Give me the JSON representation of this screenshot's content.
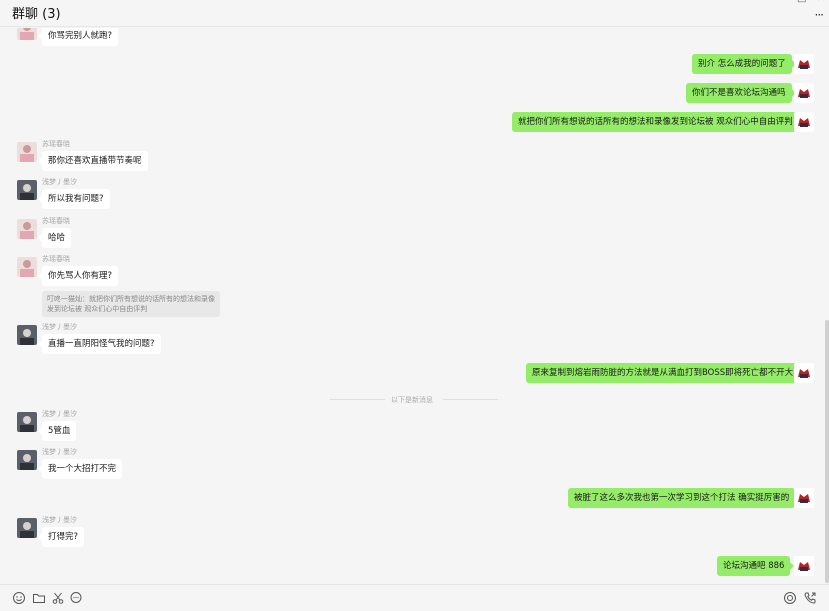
{
  "window": {
    "title": "群聊 (3)",
    "minimize_glyph": "─",
    "maximize_glyph": "□",
    "close_glyph": "✕",
    "more_glyph": "···"
  },
  "senders": {
    "a": "苏瑶春晓",
    "b": "浅梦丿墨汐"
  },
  "messages": {
    "m1": "你骂完别人就跑?",
    "m2": "别介 怎么成我的问题了",
    "m3": "你们不是喜欢论坛沟通吗",
    "m4": "就把你们所有想说的话所有的想法和录像发到论坛被 观众们心中自由评判",
    "m5": "那你还喜欢直播带节奏呢",
    "m6": "所以我有问题?",
    "m7": "哈哈",
    "m8": "你先骂人你有理?",
    "m9": "直播一直阴阳怪气我的问题?",
    "m10": "原来复制到熔岩雨防脏的方法就是从满血打到BOSS即将死亡都不开大",
    "m11": "5管血",
    "m12": "我一个大招打不完",
    "m13": "被脏了这么多次我也第一次学习到这个打法 确实挺厉害的",
    "m14": "打得完?",
    "m15": "论坛沟通吧  886"
  },
  "quote": {
    "line1": "叮咚一猫灿：就把你们所有想说的话所有的想法和录像",
    "line2": "发到论坛被 观众们心中自由评判"
  },
  "divider": "以下是新消息",
  "icons": {
    "emoji": "emoji-icon",
    "folder": "folder-icon",
    "scissors": "scissors-icon",
    "chat": "chat-bubble-icon",
    "voice": "voice-call-icon",
    "video": "video-call-icon"
  },
  "colors": {
    "background": "#f5f5f5",
    "bubble_self": "#95ec69",
    "bubble_other": "#ffffff",
    "sender_name": "#a5a5a5"
  }
}
